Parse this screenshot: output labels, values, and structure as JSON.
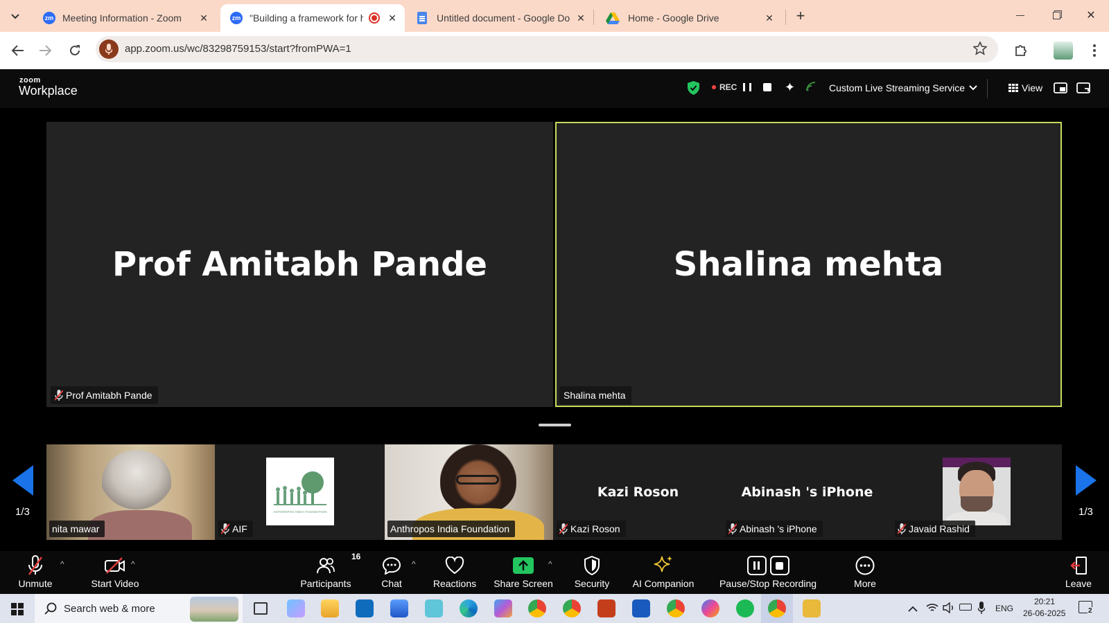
{
  "browser": {
    "tabs": [
      {
        "title": "Meeting Information - Zoom",
        "favicon": "zm",
        "color": "#2d6cf6"
      },
      {
        "title": "\"Building a framework for h",
        "favicon": "zm",
        "color": "#2d6cf6",
        "recording": true
      },
      {
        "title": "Untitled document - Google Do",
        "favicon": "docs",
        "color": "#4a86e8"
      },
      {
        "title": "Home - Google Drive",
        "favicon": "drive",
        "color": "#34a853"
      }
    ],
    "url": "app.zoom.us/wc/83298759153/start?fromPWA=1"
  },
  "zoom_top": {
    "logo_line1": "zoom",
    "logo_line2": "Workplace",
    "rec_label": "REC",
    "streaming_label": "Custom Live Streaming Service",
    "view_label": "View"
  },
  "main_tiles": [
    {
      "name": "Prof Amitabh Pande",
      "badge": "Prof Amitabh Pande",
      "muted": true,
      "active_speaker": false
    },
    {
      "name": "Shalina mehta",
      "badge": "Shalina mehta",
      "muted": false,
      "active_speaker": true
    }
  ],
  "strip_tiles": [
    {
      "badge": "nita mawar",
      "muted": false,
      "type": "video"
    },
    {
      "badge": "AIF",
      "muted": true,
      "type": "logo",
      "logo_text": "ANTHROPOS INDIA FOUNDATION"
    },
    {
      "badge": "Anthropos India Foundation",
      "muted": false,
      "type": "video"
    },
    {
      "name": "Kazi Roson",
      "badge": "Kazi Roson",
      "muted": true,
      "type": "name"
    },
    {
      "name": "Abinash 's iPhone",
      "badge": "Abinash 's iPhone",
      "muted": true,
      "type": "name"
    },
    {
      "badge": "Javaid Rashid",
      "muted": true,
      "type": "avatar"
    }
  ],
  "pagination": {
    "left": "1/3",
    "right": "1/3"
  },
  "controls": {
    "unmute": "Unmute",
    "start_video": "Start Video",
    "participants": "Participants",
    "participant_count": "16",
    "chat": "Chat",
    "reactions": "Reactions",
    "share_screen": "Share Screen",
    "security": "Security",
    "ai_companion": "AI Companion",
    "pause_stop_recording": "Pause/Stop Recording",
    "more": "More",
    "leave": "Leave"
  },
  "taskbar": {
    "search_placeholder": "Search web & more",
    "language": "ENG",
    "time": "20:21",
    "date": "26-06-2025",
    "notification_count": "2"
  },
  "colors": {
    "accent_speaker_border": "#c8dc5c",
    "zoom_blue": "#1a73e8",
    "share_green": "#22c55e",
    "tabbar_bg": "#fbd9c8"
  }
}
